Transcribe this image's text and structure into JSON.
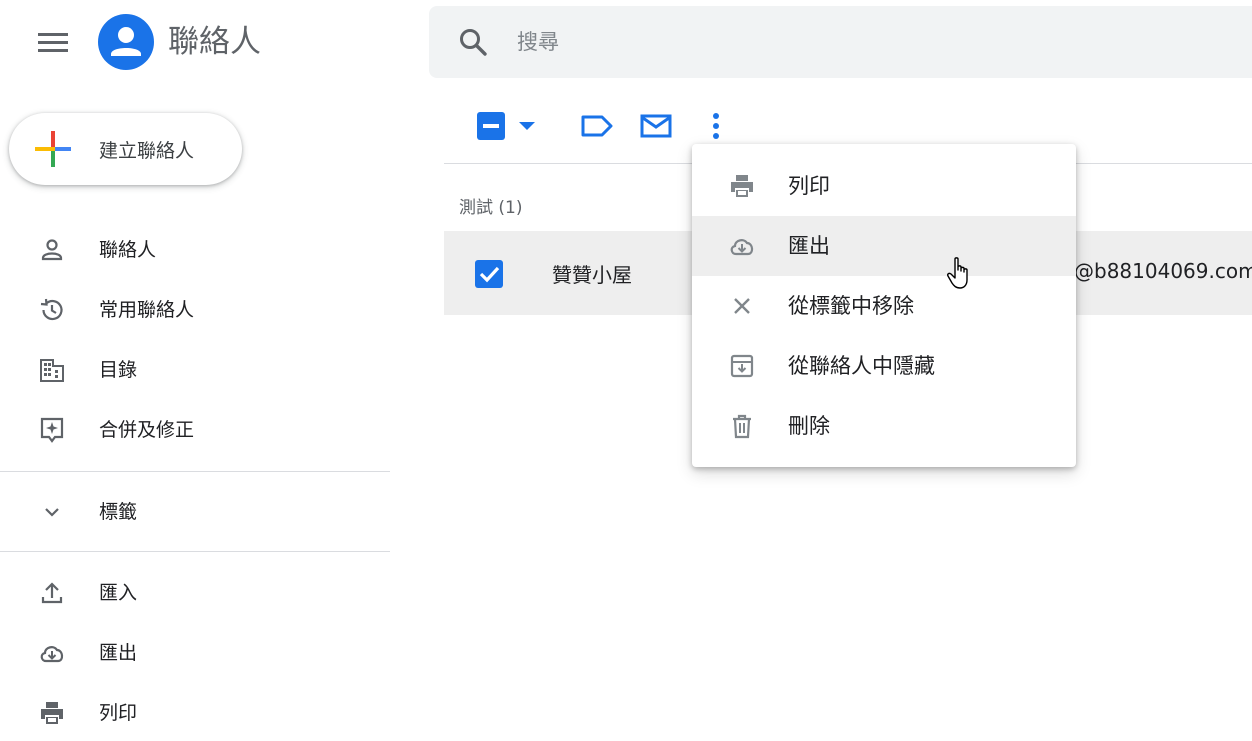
{
  "header": {
    "app_title": "聯絡人",
    "menu_icon": "hamburger-menu-icon",
    "logo_icon": "contacts-person-icon"
  },
  "search": {
    "placeholder": "搜尋"
  },
  "create_button": {
    "label": "建立聯絡人"
  },
  "sidebar": {
    "items": [
      {
        "label": "聯絡人",
        "icon": "person-icon"
      },
      {
        "label": "常用聯絡人",
        "icon": "history-icon"
      },
      {
        "label": "目錄",
        "icon": "domain-icon"
      },
      {
        "label": "合併及修正",
        "icon": "merge-fix-icon"
      }
    ],
    "labels_section": {
      "label": "標籤",
      "icon": "chevron-down-icon"
    },
    "bottom_items": [
      {
        "label": "匯入",
        "icon": "upload-icon"
      },
      {
        "label": "匯出",
        "icon": "cloud-download-icon"
      },
      {
        "label": "列印",
        "icon": "printer-icon"
      }
    ]
  },
  "toolbar": {
    "select_state": "partial",
    "icons": [
      "select-checkbox-icon",
      "dropdown-arrow-icon",
      "label-icon",
      "email-icon",
      "more-vert-icon"
    ]
  },
  "contacts": {
    "group_label": "測試 (1)",
    "rows": [
      {
        "name": "贊贊小屋",
        "email": "@b88104069.com",
        "checked": true
      }
    ]
  },
  "more_menu": {
    "items": [
      {
        "label": "列印",
        "icon": "printer-icon"
      },
      {
        "label": "匯出",
        "icon": "cloud-download-icon",
        "hovered": true
      },
      {
        "label": "從標籤中移除",
        "icon": "close-icon"
      },
      {
        "label": "從聯絡人中隱藏",
        "icon": "archive-icon"
      },
      {
        "label": "刪除",
        "icon": "trash-icon"
      }
    ]
  },
  "colors": {
    "accent": "#1a73e8",
    "icon_gray": "#5f6368",
    "menu_icon_gray": "#80868b",
    "search_bg": "#f1f3f4",
    "row_selected_bg": "#eeeeee"
  }
}
